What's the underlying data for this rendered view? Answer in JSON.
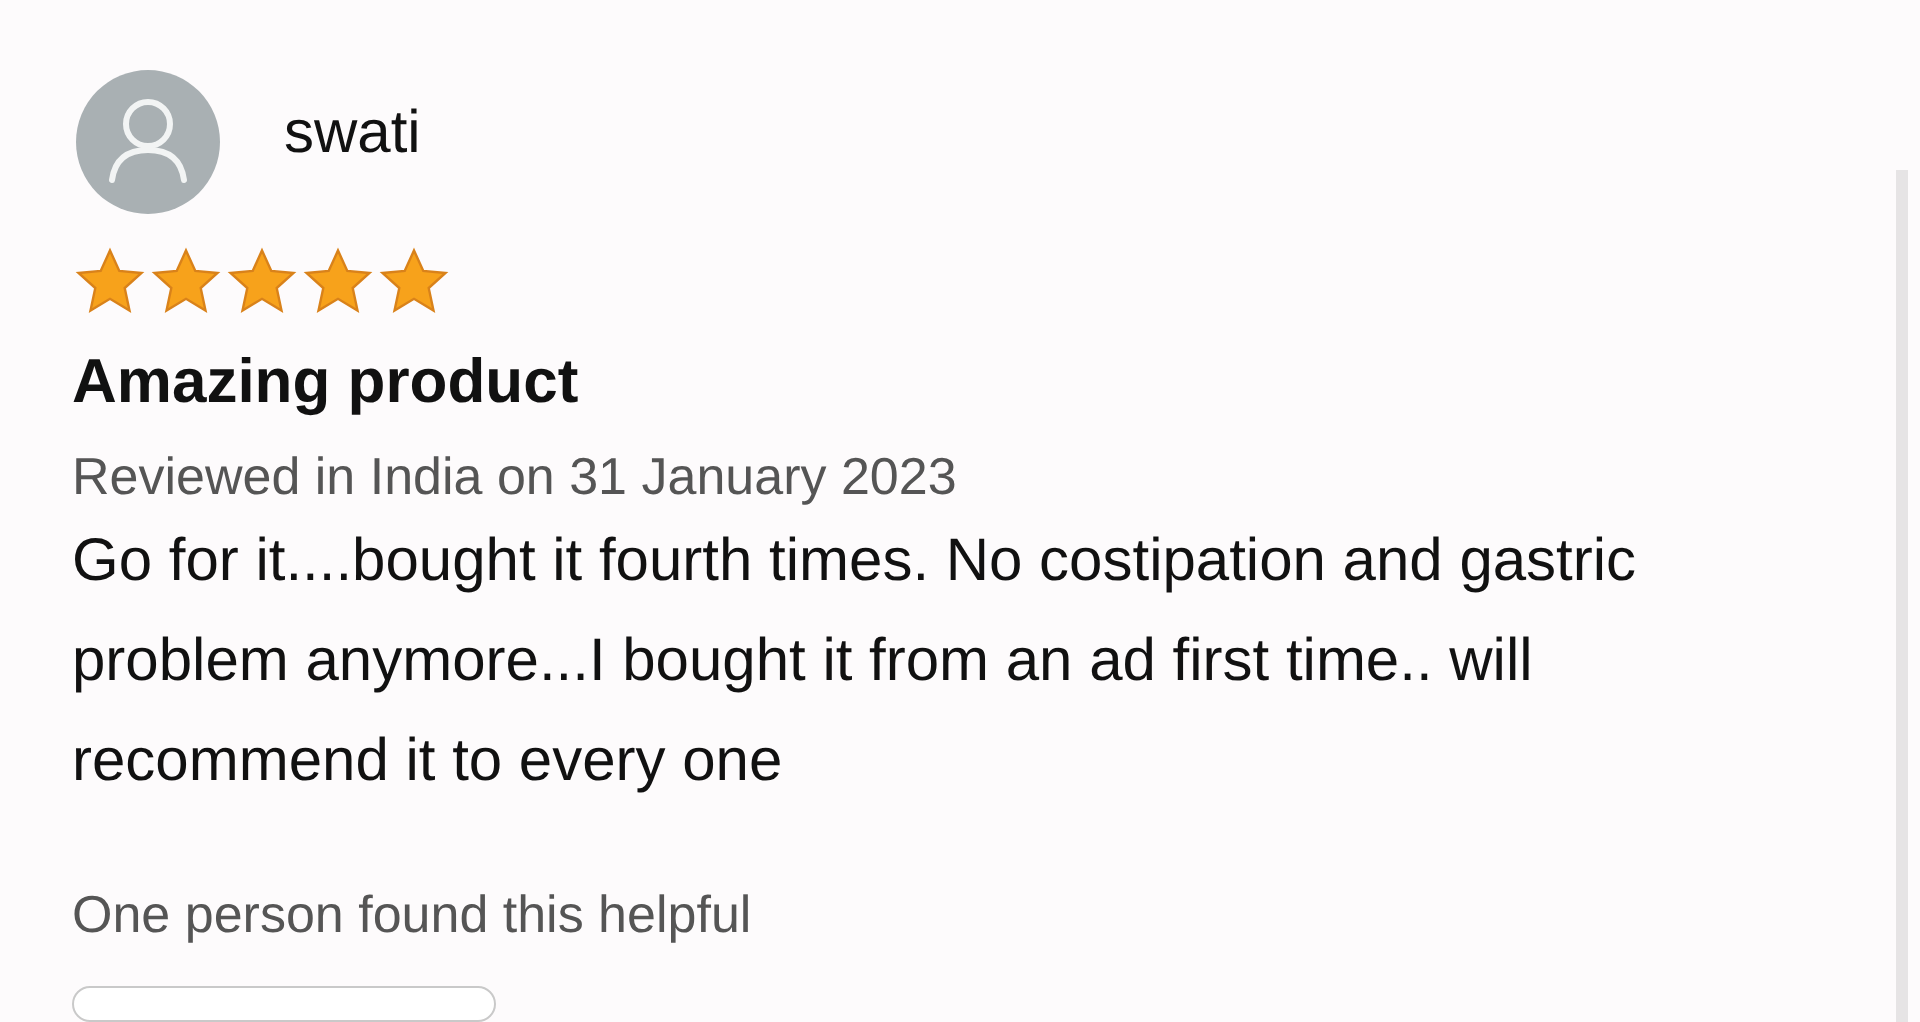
{
  "review": {
    "reviewer": "swati",
    "stars": 5,
    "title": "Amazing product",
    "meta": "Reviewed in India on 31 January 2023",
    "body": "Go for it....bought it fourth times. No costipation and gastric problem anymore...I bought it from an ad first time.. will recommend it to every one",
    "helpful": "One person found this helpful"
  }
}
